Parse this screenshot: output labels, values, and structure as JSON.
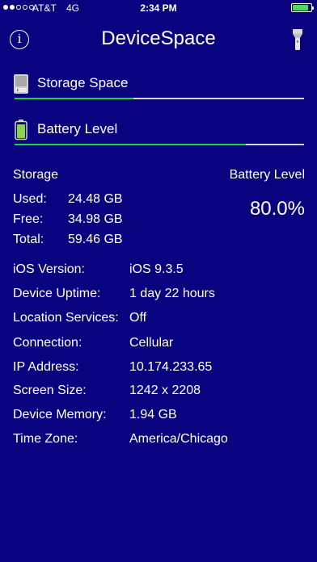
{
  "status_bar": {
    "carrier": "AT&T",
    "network": "4G",
    "time": "2:34 PM",
    "battery_level": 0.8,
    "battery_color": "#4cd964"
  },
  "nav": {
    "title": "DeviceSpace",
    "info_icon": "info-icon",
    "flashlight_icon": "flashlight-icon"
  },
  "meters": {
    "storage_label": "Storage Space",
    "storage_used_fraction": 0.41,
    "battery_label": "Battery Level",
    "battery_fraction": 0.8,
    "fill_color": "#1fd83a"
  },
  "storage": {
    "heading": "Storage",
    "rows": [
      {
        "key": "Used:",
        "value": "24.48 GB"
      },
      {
        "key": "Free:",
        "value": "34.98 GB"
      },
      {
        "key": "Total:",
        "value": "59.46 GB"
      }
    ]
  },
  "battery": {
    "heading": "Battery Level",
    "percent": "80.0%"
  },
  "info": [
    {
      "key": "iOS Version:",
      "value": "iOS 9.3.5"
    },
    {
      "key": "Device Uptime:",
      "value": "1 day 22 hours"
    },
    {
      "key": "Location Services:",
      "value": "Off"
    },
    {
      "key": "Connection:",
      "value": "Cellular"
    },
    {
      "key": "IP Address:",
      "value": "10.174.233.65"
    },
    {
      "key": "Screen Size:",
      "value": "1242 x 2208"
    },
    {
      "key": "Device Memory:",
      "value": "1.94 GB"
    },
    {
      "key": "Time Zone:",
      "value": "America/Chicago"
    }
  ],
  "colors": {
    "background": "#0a037f",
    "text": "#ffffff"
  }
}
